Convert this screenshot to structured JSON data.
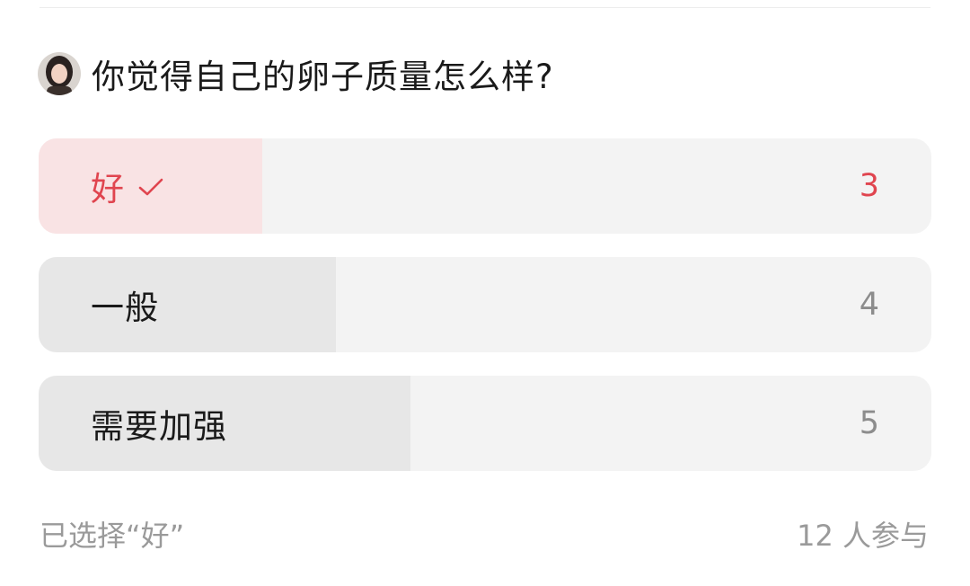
{
  "poll": {
    "question": "你觉得自己的卵子质量怎么样?",
    "options": [
      {
        "label": "好",
        "count": "3",
        "selected": true,
        "share": 0.25
      },
      {
        "label": "一般",
        "count": "4",
        "selected": false,
        "share": 0.333
      },
      {
        "label": "需要加强",
        "count": "5",
        "selected": false,
        "share": 0.417
      }
    ],
    "status_text": "已选择“好”",
    "participants_text": "12 人参与"
  },
  "colors": {
    "selected_accent": "#e0454f",
    "selected_fill": "#f9e3e4",
    "bar_fill": "#e7e7e7",
    "bar_track": "#f3f3f3",
    "muted_text": "#9a9a9a"
  },
  "icons": {
    "avatar": "user-avatar-photo",
    "selected_mark": "checkmark-icon"
  }
}
